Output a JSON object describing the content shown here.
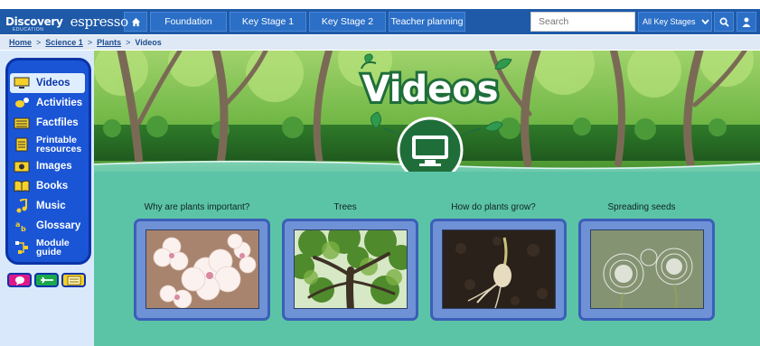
{
  "header": {
    "logo_brand": "Discovery",
    "logo_sub": "EDUCATION",
    "logo_product": "espresso",
    "nav": [
      {
        "label": "Foundation"
      },
      {
        "label": "Key Stage 1"
      },
      {
        "label": "Key Stage 2"
      },
      {
        "label": "Teacher planning"
      }
    ],
    "search_placeholder": "Search",
    "key_stage_select": "All Key Stages"
  },
  "breadcrumb": {
    "items": [
      "Home",
      "Science 1",
      "Plants"
    ],
    "current": "Videos",
    "separator": ">"
  },
  "sidebar": {
    "items": [
      {
        "label": "Videos",
        "icon": "monitor-icon",
        "active": true
      },
      {
        "label": "Activities",
        "icon": "activities-icon"
      },
      {
        "label": "Factfiles",
        "icon": "factfiles-icon"
      },
      {
        "label1": "Printable",
        "label2": "resources",
        "icon": "printable-icon"
      },
      {
        "label": "Images",
        "icon": "images-icon"
      },
      {
        "label": "Books",
        "icon": "books-icon"
      },
      {
        "label": "Music",
        "icon": "music-note-icon"
      },
      {
        "label": "Glossary",
        "icon": "glossary-icon"
      },
      {
        "label1": "Module",
        "label2": "guide",
        "icon": "module-guide-icon"
      }
    ],
    "tools": [
      "speech-bubble-icon",
      "toggle-icon",
      "notepad-icon"
    ]
  },
  "banner": {
    "title": "Videos"
  },
  "cards": [
    {
      "title": "Why are plants important?",
      "image": "white-blossom-flowers"
    },
    {
      "title": "Trees",
      "image": "tree-canopy"
    },
    {
      "title": "How do plants grow?",
      "image": "seedling-in-soil"
    },
    {
      "title": "Spreading seeds",
      "image": "dandelion-seed-heads"
    }
  ],
  "colors": {
    "nav_bg": "#1e5aa8",
    "sidebar_menu": "#1a55d6",
    "content_bg": "#5bc4a6",
    "card_bg": "#6f91d6",
    "banner_logo": "#1f8f4f"
  }
}
